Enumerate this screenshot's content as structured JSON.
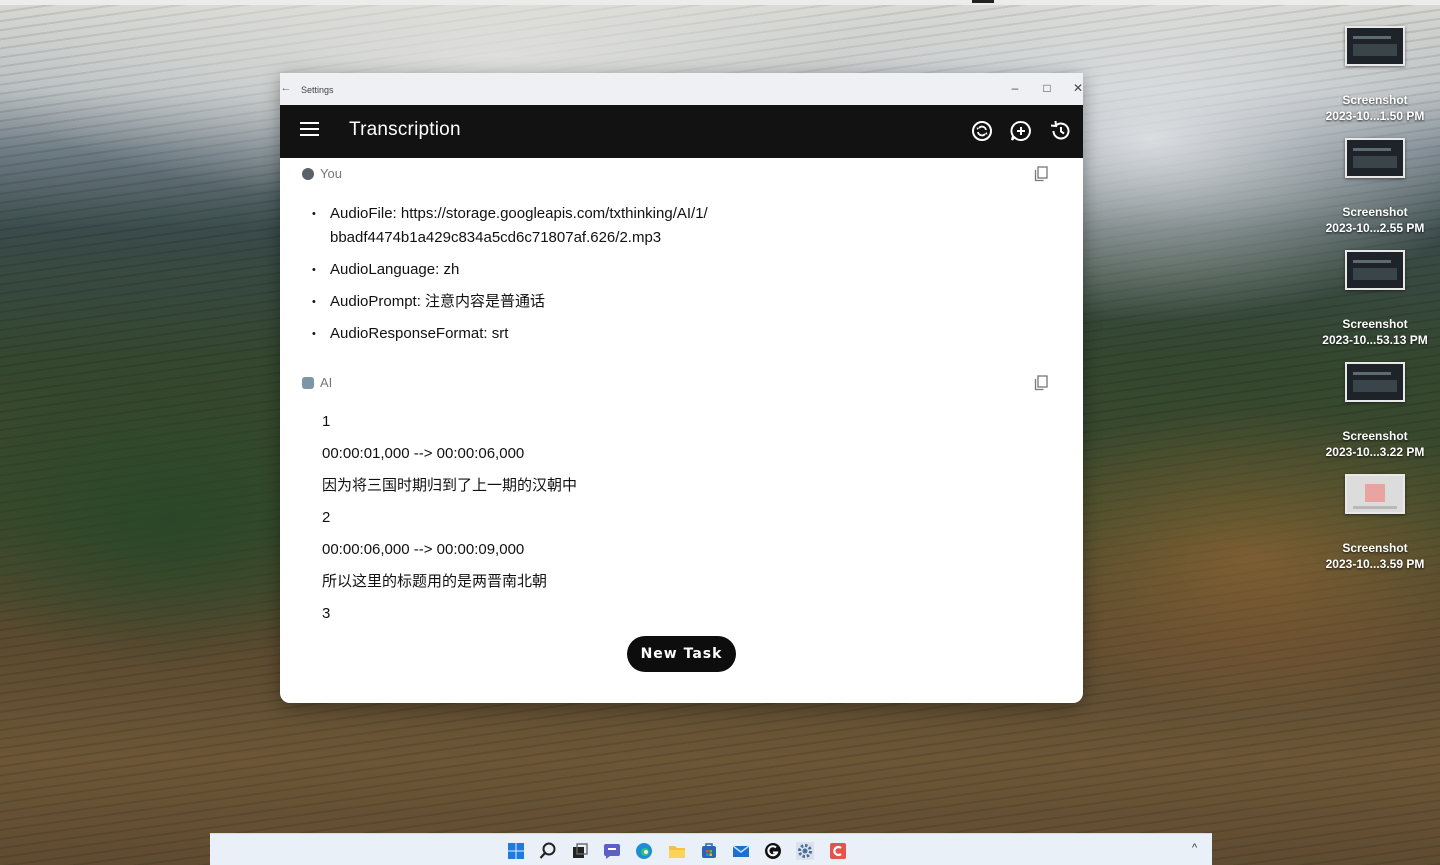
{
  "window": {
    "titlebar_title": "Settings",
    "back_glyph": "←",
    "minimize_glyph": "–",
    "maximize_glyph": "□",
    "close_glyph": "✕"
  },
  "appbar": {
    "title": "Transcription",
    "menu_icon": "hamburger-menu-icon",
    "actions": [
      "settings-sync-icon",
      "add-chat-icon",
      "history-icon"
    ]
  },
  "messages": {
    "user": {
      "label": "You",
      "items": [
        "AudioFile: https://storage.googleapis.com/txthinking/AI/1/",
        "bbadf4474b1a429c834a5cd6c71807af.626/2.mp3",
        "AudioLanguage: zh",
        "AudioPrompt: 注意内容是普通话",
        "AudioResponseFormat: srt"
      ]
    },
    "ai": {
      "label": "AI",
      "lines": [
        "1",
        "00:00:01,000 --> 00:00:06,000",
        "因为将三国时期归到了上一期的汉朝中",
        "2",
        "00:00:06,000 --> 00:00:09,000",
        "所以这里的标题用的是两晋南北朝",
        "3"
      ]
    }
  },
  "new_task_label": "New Task",
  "desktop": {
    "icons": [
      {
        "line1": "Screenshot",
        "line2": "2023-10...1.50 PM"
      },
      {
        "line1": "Screenshot",
        "line2": "2023-10...2.55 PM"
      },
      {
        "line1": "Screenshot",
        "line2": "2023-10...53.13 PM"
      },
      {
        "line1": "Screenshot",
        "line2": "2023-10...3.22 PM"
      },
      {
        "line1": "Screenshot",
        "line2": "2023-10...3.59 PM"
      }
    ]
  },
  "taskbar": {
    "icons": [
      "windows-start-icon",
      "search-icon",
      "task-view-icon",
      "chat-icon",
      "edge-icon",
      "file-explorer-icon",
      "store-icon",
      "mail-icon",
      "github-icon",
      "settings-gear-icon",
      "app-c-icon"
    ],
    "tray_glyph": "^"
  },
  "colors": {
    "appbar_bg": "#121212",
    "button_bg": "#0d0d0d",
    "text": "#111111"
  }
}
